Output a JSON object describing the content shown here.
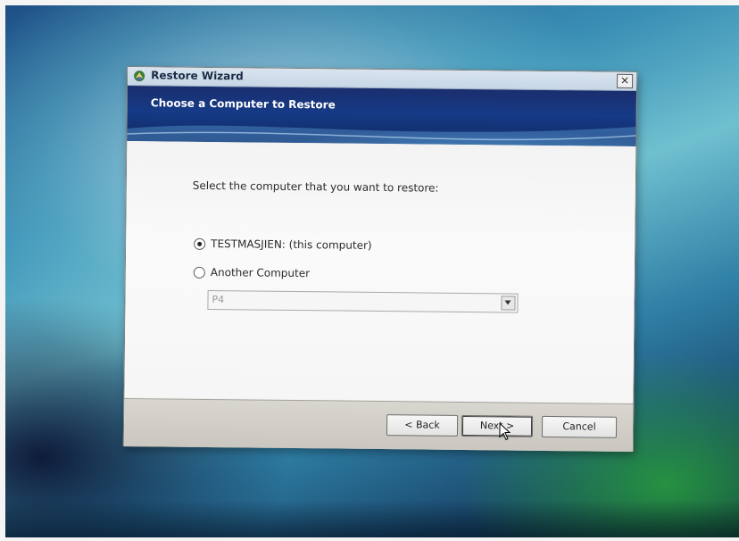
{
  "window": {
    "title": "Restore Wizard",
    "close_glyph": "×",
    "icon": "wizard-icon"
  },
  "banner": {
    "title": "Choose a Computer to Restore"
  },
  "content": {
    "prompt": "Select the computer that you want to restore:",
    "options": [
      {
        "label": "TESTMASJIEN: (this computer)",
        "selected": true
      },
      {
        "label": "Another Computer",
        "selected": false
      }
    ],
    "computer_select": {
      "value": "P4",
      "enabled": false
    }
  },
  "footer": {
    "back_label": "< Back",
    "next_label": "Next >",
    "cancel_label": "Cancel"
  },
  "colors": {
    "banner": "#163a86",
    "footer": "#d0cec7",
    "content": "#f6f6f6"
  }
}
